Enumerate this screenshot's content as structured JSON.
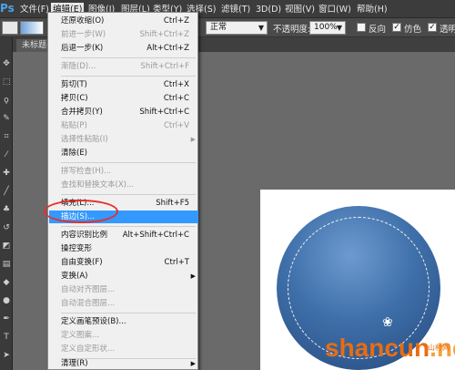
{
  "app": {
    "logo": "Ps"
  },
  "menubar": {
    "items": [
      {
        "label": "文件(F)",
        "active": false
      },
      {
        "label": "编辑(E)",
        "active": true
      },
      {
        "label": "图像(I)",
        "active": false
      },
      {
        "label": "图层(L)",
        "active": false
      },
      {
        "label": "类型(Y)",
        "active": false
      },
      {
        "label": "选择(S)",
        "active": false
      },
      {
        "label": "滤镜(T)",
        "active": false
      },
      {
        "label": "3D(D)",
        "active": false
      },
      {
        "label": "视图(V)",
        "active": false
      },
      {
        "label": "窗口(W)",
        "active": false
      },
      {
        "label": "帮助(H)",
        "active": false
      }
    ]
  },
  "options": {
    "mode_value": "正常",
    "opacity_label": "不透明度:",
    "opacity_value": "100%",
    "reverse_label": "反向",
    "dither_label": "仿色",
    "transparency_label": "透明"
  },
  "document": {
    "tab_label": "未标题-"
  },
  "edit_menu": [
    {
      "label": "还原收缩(O)",
      "shortcut": "Ctrl+Z",
      "disabled": false
    },
    {
      "label": "前进一步(W)",
      "shortcut": "Shift+Ctrl+Z",
      "disabled": true
    },
    {
      "label": "后退一步(K)",
      "shortcut": "Alt+Ctrl+Z",
      "disabled": false
    },
    {
      "label": "渐隐(D)...",
      "shortcut": "Shift+Ctrl+F",
      "disabled": true
    },
    {
      "label": "剪切(T)",
      "shortcut": "Ctrl+X",
      "disabled": false
    },
    {
      "label": "拷贝(C)",
      "shortcut": "Ctrl+C",
      "disabled": false
    },
    {
      "label": "合并拷贝(Y)",
      "shortcut": "Shift+Ctrl+C",
      "disabled": false
    },
    {
      "label": "粘贴(P)",
      "shortcut": "Ctrl+V",
      "disabled": true
    },
    {
      "label": "选择性粘贴(I)",
      "shortcut": "",
      "disabled": true,
      "submenu": true
    },
    {
      "label": "清除(E)",
      "shortcut": "",
      "disabled": false
    },
    {
      "label": "拼写检查(H)...",
      "shortcut": "",
      "disabled": true
    },
    {
      "label": "查找和替换文本(X)...",
      "shortcut": "",
      "disabled": true
    },
    {
      "label": "填充(L)...",
      "shortcut": "Shift+F5",
      "disabled": false
    },
    {
      "label": "描边(S)...",
      "shortcut": "",
      "disabled": false,
      "highlighted": true
    },
    {
      "label": "内容识别比例",
      "shortcut": "Alt+Shift+Ctrl+C",
      "disabled": false
    },
    {
      "label": "操控变形",
      "shortcut": "",
      "disabled": false
    },
    {
      "label": "自由变换(F)",
      "shortcut": "Ctrl+T",
      "disabled": false
    },
    {
      "label": "变换(A)",
      "shortcut": "",
      "disabled": false,
      "submenu": true
    },
    {
      "label": "自动对齐图层...",
      "shortcut": "",
      "disabled": true
    },
    {
      "label": "自动混合图层...",
      "shortcut": "",
      "disabled": true
    },
    {
      "label": "定义画笔预设(B)...",
      "shortcut": "",
      "disabled": false
    },
    {
      "label": "定义图案...",
      "shortcut": "",
      "disabled": true
    },
    {
      "label": "定义自定形状...",
      "shortcut": "",
      "disabled": true
    },
    {
      "label": "清理(R)",
      "shortcut": "",
      "disabled": false,
      "submenu": true
    }
  ],
  "watermark": {
    "brand": "shancun",
    "suffix": ".net",
    "small": "山村网"
  },
  "colors": {
    "highlight": "#3399ff",
    "annotation": "#e23030",
    "circle": "#3f6fa9",
    "watermark": "#e86d13"
  }
}
